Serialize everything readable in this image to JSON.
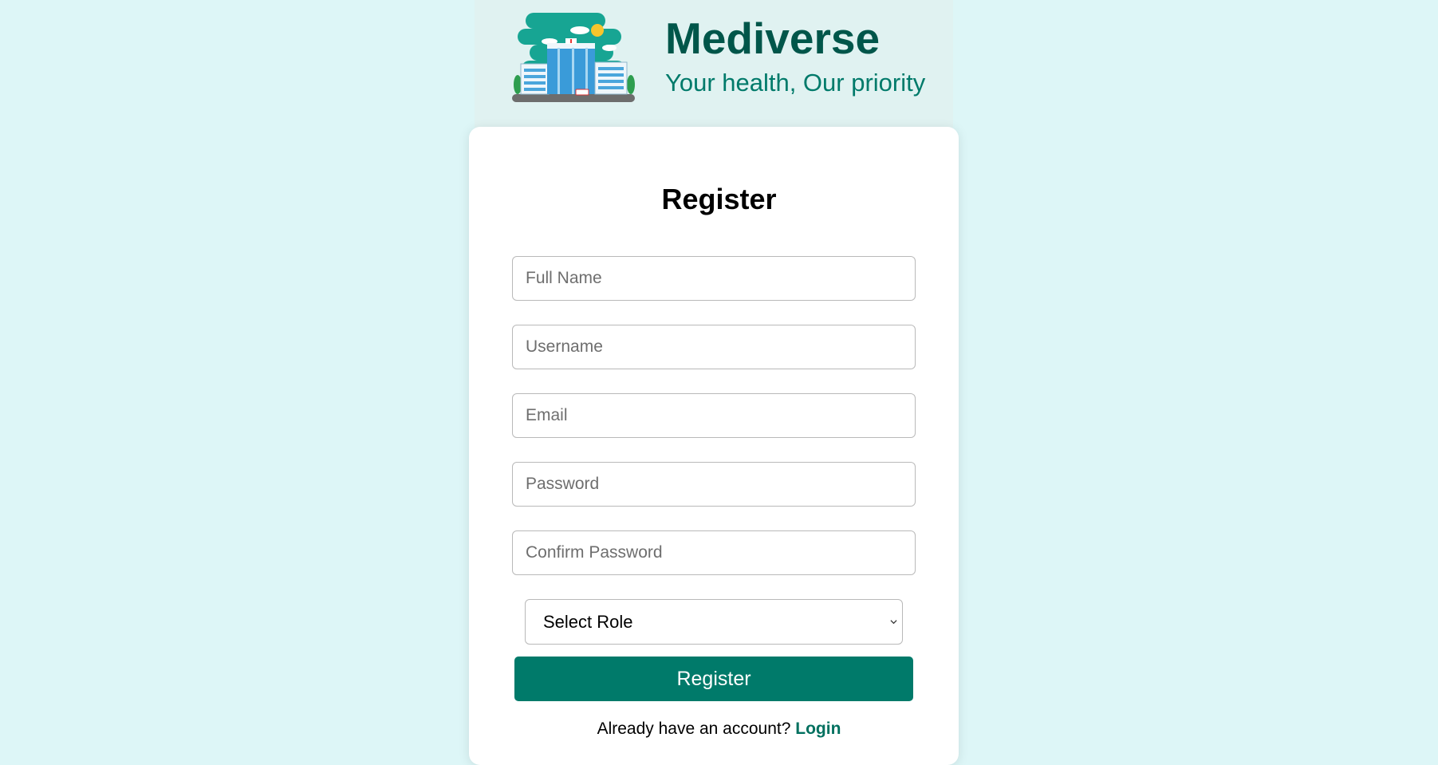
{
  "brand": {
    "name": "Mediverse",
    "tagline": "Your health, Our priority",
    "logo_icon": "hospital-building-icon"
  },
  "form": {
    "title": "Register",
    "fields": {
      "full_name": {
        "placeholder": "Full Name",
        "value": ""
      },
      "username": {
        "placeholder": "Username",
        "value": ""
      },
      "email": {
        "placeholder": "Email",
        "value": ""
      },
      "password": {
        "placeholder": "Password",
        "value": ""
      },
      "confirm_password": {
        "placeholder": "Confirm Password",
        "value": ""
      }
    },
    "role_select": {
      "selected": "Select Role"
    },
    "submit_label": "Register",
    "footer_prompt": "Already have an account?",
    "login_label": "Login"
  },
  "colors": {
    "page_background": "#ddf6f7",
    "header_background": "#e0f2f1",
    "accent": "#007a6a",
    "brand_dark": "#00564a"
  }
}
